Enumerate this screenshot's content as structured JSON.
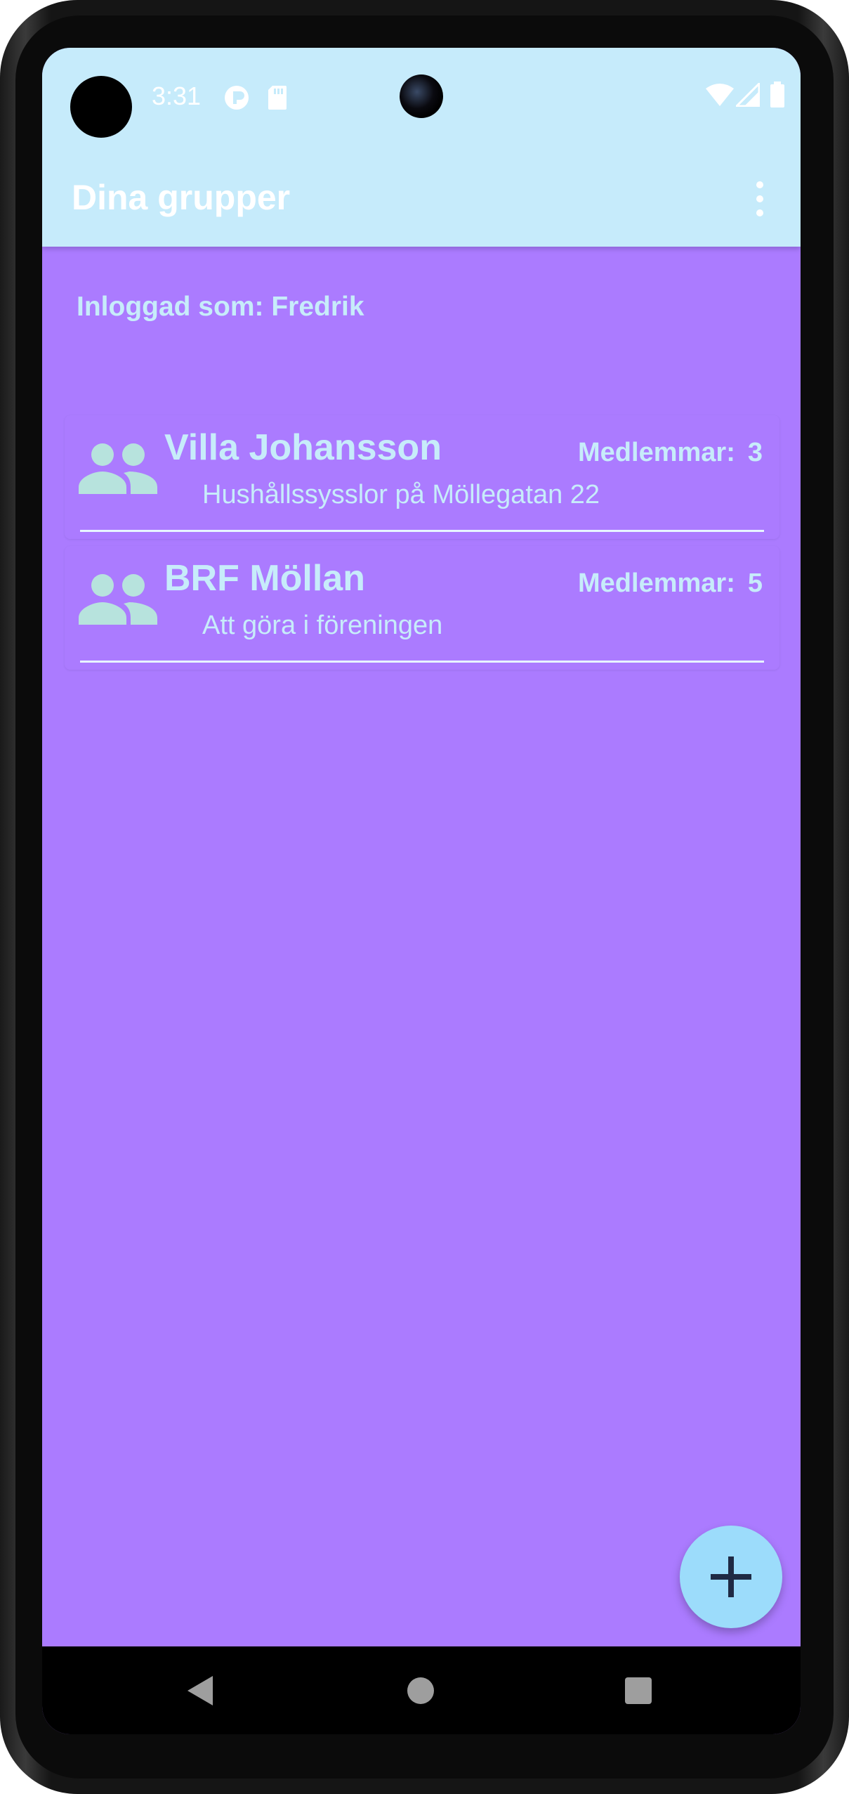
{
  "status_bar": {
    "time": "3:31"
  },
  "app_bar": {
    "title": "Dina grupper",
    "menu_icon": "overflow-menu-icon"
  },
  "user": {
    "logged_in_text": "Inloggad som: Fredrik"
  },
  "groups": [
    {
      "name": "Villa Johansson",
      "description": "Hushållssysslor på Möllegatan 22",
      "members_label": "Medlemmar:",
      "members_count": "3",
      "icon": "group-icon"
    },
    {
      "name": "BRF Möllan",
      "description": "Att göra i föreningen",
      "members_label": "Medlemmar:",
      "members_count": "5",
      "icon": "group-icon"
    }
  ],
  "fab": {
    "icon": "add-icon"
  },
  "colors": {
    "app_bar": "#c6ebfb",
    "background": "#ab7bff",
    "text_accent": "#c7ecfa",
    "fab": "#9cdcfb",
    "group_icon": "#b7e3dd"
  }
}
